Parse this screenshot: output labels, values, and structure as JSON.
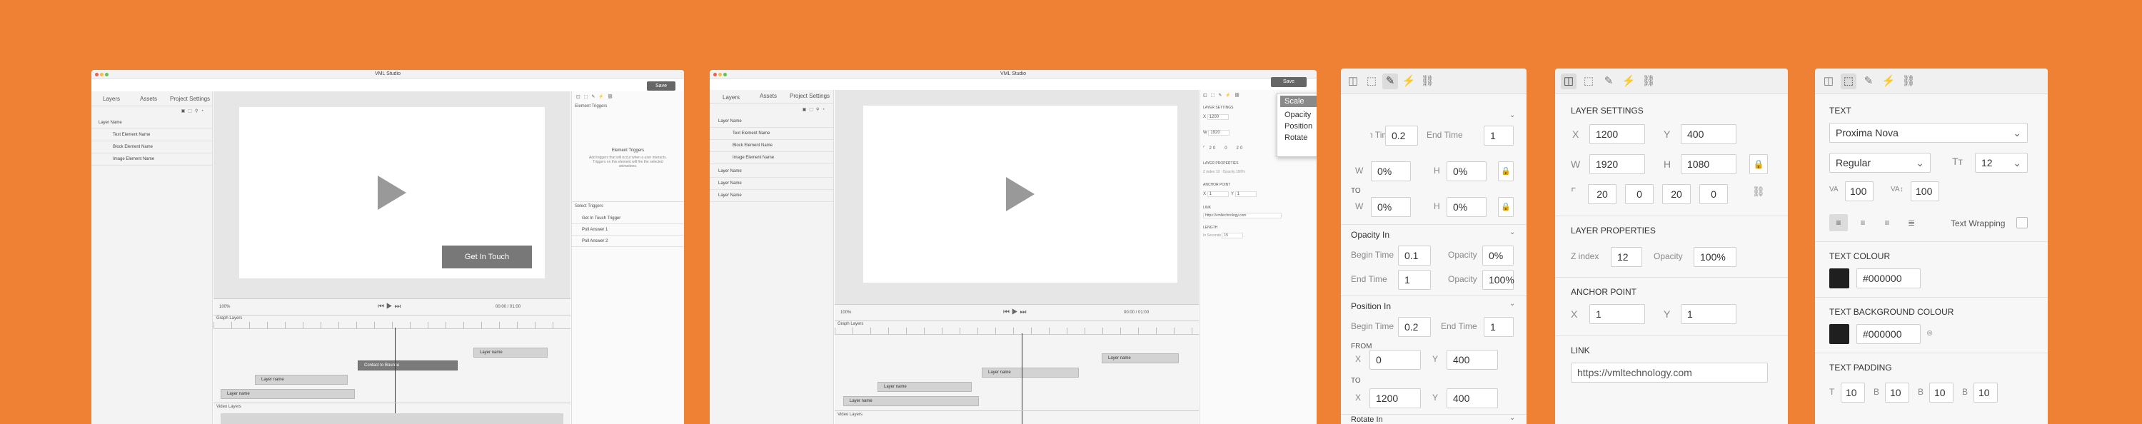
{
  "app_title": "VML Studio",
  "save_label": "Save",
  "tabs": [
    "Layers",
    "Assets",
    "Project Settings"
  ],
  "w1": {
    "layers": [
      "Layer Name",
      "Text Element Name",
      "Block Element Name",
      "Image Element Name"
    ],
    "cta": "Get In Touch",
    "zoom": "100%",
    "timecode": "00:00 / 01:00",
    "graph_label": "Graph Layers",
    "video_label": "Video Layers",
    "tl_bars": [
      "Layer name",
      "Layer name",
      "Layer name",
      "Contact to Bounce"
    ],
    "triggers_title": "Element Triggers",
    "triggers_text": "Add triggers that will occur when a user interacts. Triggers on this element will fire the selected animations.",
    "actions_title": "Select Triggers",
    "actions": [
      "Get In Touch Trigger",
      "Poll Answer 1",
      "Poll Answer 2"
    ]
  },
  "w2": {
    "layers": [
      "Layer Name",
      "Text Element Name",
      "Block Element Name",
      "Image Element Name",
      "Layer Name",
      "Layer Name",
      "Layer Name"
    ],
    "zoom": "100%",
    "timecode": "00:00 / 01:00",
    "graph_label": "Graph Layers",
    "video_label": "Video Layers",
    "tl_bars": [
      "Layer name",
      "Layer name",
      "Layer name",
      "Layer name"
    ],
    "dropdown": [
      "Scale",
      "Opacity",
      "Position",
      "Rotate"
    ],
    "layer_settings": "LAYER SETTINGS",
    "x": "1200",
    "y": "400",
    "w": "1920",
    "h": "1080",
    "r": [
      "20",
      "0",
      "20",
      "0"
    ],
    "layer_props": "LAYER PROPERTIES",
    "zindex": "10",
    "opacity": "100%",
    "anchor": "ANCHOR POINT",
    "ax": "1",
    "ay": "1",
    "link": "LINK",
    "link_val": "https://vmltechnology.com",
    "length": "LENGTH",
    "length_label": "In Seconds",
    "length_val": "15"
  },
  "p3": {
    "begin": "0.2",
    "end": "1",
    "from_w": "0%",
    "from_h": "0%",
    "to_label": "TO",
    "to_w": "0%",
    "to_h": "0%",
    "opacity_title": "Opacity In",
    "op_begin": "0.1",
    "op_from": "0%",
    "op_end": "1",
    "op_to": "100%",
    "position_title": "Position In",
    "pos_begin": "0.2",
    "pos_end": "1",
    "from_label": "FROM",
    "from_x": "0",
    "from_y": "400",
    "to_x": "1200",
    "to_y": "400",
    "rotate_title": "Rotate In",
    "labels": {
      "begin": "Begin Time",
      "end": "End Time",
      "opacity": "Opacity",
      "w": "W",
      "h": "H",
      "x": "X",
      "y": "Y"
    }
  },
  "p4": {
    "layer_settings": "LAYER  SETTINGS",
    "x": "1200",
    "y": "400",
    "w": "1920",
    "h": "1080",
    "r": [
      "20",
      "0",
      "20",
      "0"
    ],
    "layer_props": "LAYER  PROPERTIES",
    "zindex_label": "Z index",
    "zindex": "12",
    "opacity_label": "Opacity",
    "opacity": "100%",
    "anchor": "ANCHOR POINT",
    "ax": "1",
    "ay": "1",
    "link": "LINK",
    "link_val": "https://vmltechnology.com",
    "labels": {
      "x": "X",
      "y": "Y",
      "w": "W",
      "h": "H"
    }
  },
  "p5": {
    "text_title": "TEXT",
    "font": "Proxima Nova",
    "weight": "Regular",
    "size": "12",
    "tracking": "100",
    "leading": "100",
    "wrap": "Text Wrapping",
    "colour_title": "TEXT COLOUR",
    "colour": "#000000",
    "bg_title": "TEXT BACKGROUND COLOUR",
    "bg": "#000000",
    "padding_title": "TEXT PADDING",
    "padding": [
      {
        "k": "T",
        "v": "10"
      },
      {
        "k": "B",
        "v": "10"
      },
      {
        "k": "B",
        "v": "10"
      },
      {
        "k": "B",
        "v": "10"
      }
    ]
  },
  "colors": {
    "background": "#ee8133",
    "panel": "#f7f7f7",
    "accent": "#333333"
  }
}
